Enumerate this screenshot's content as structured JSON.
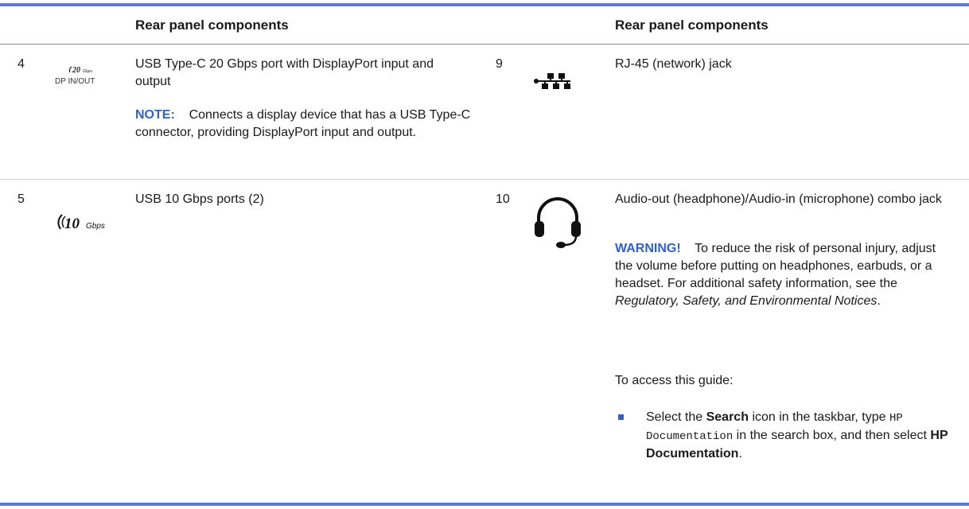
{
  "header": {
    "left_title": "Rear panel components",
    "right_title": "Rear panel components"
  },
  "rows": {
    "r4": {
      "num": "4",
      "icon_name": "usb-c-20gbps-dp-icon",
      "icon_text_top": "20",
      "icon_text_sub": "Gbps",
      "icon_text_bottom": "DP IN/OUT",
      "desc": "USB Type-C 20 Gbps port with DisplayPort input and output",
      "note_label": "NOTE:",
      "note_text": "Connects a display device that has a USB Type-C connector, providing DisplayPort input and output."
    },
    "r5": {
      "num": "5",
      "icon_name": "usb-10gbps-icon",
      "icon_text_top": "10",
      "icon_text_sub": "Gbps",
      "desc": "USB 10 Gbps ports (2)"
    },
    "r9": {
      "num": "9",
      "icon_name": "network-icon",
      "desc": "RJ-45 (network) jack"
    },
    "r10": {
      "num": "10",
      "icon_name": "headset-icon",
      "desc": "Audio-out (headphone)/Audio-in (microphone) combo jack",
      "warning_label": "WARNING!",
      "warning_text": "To reduce the risk of personal injury, adjust the volume before putting on headphones, earbuds, or a headset. For additional safety information, see the",
      "warning_italic": "Regulatory, Safety, and Environmental Notices",
      "warning_end": ".",
      "access_text": "To access this guide:",
      "bullet_1": "Select the",
      "bullet_search": "Search",
      "bullet_2": "icon in the taskbar, type",
      "bullet_code": "HP Documentation",
      "bullet_3": "in the search box, and then select",
      "bullet_hpdoc": "HP Documentation",
      "bullet_end": "."
    }
  },
  "colors": {
    "accent": "#2f5fd6",
    "rule": "#5b7bd6"
  }
}
